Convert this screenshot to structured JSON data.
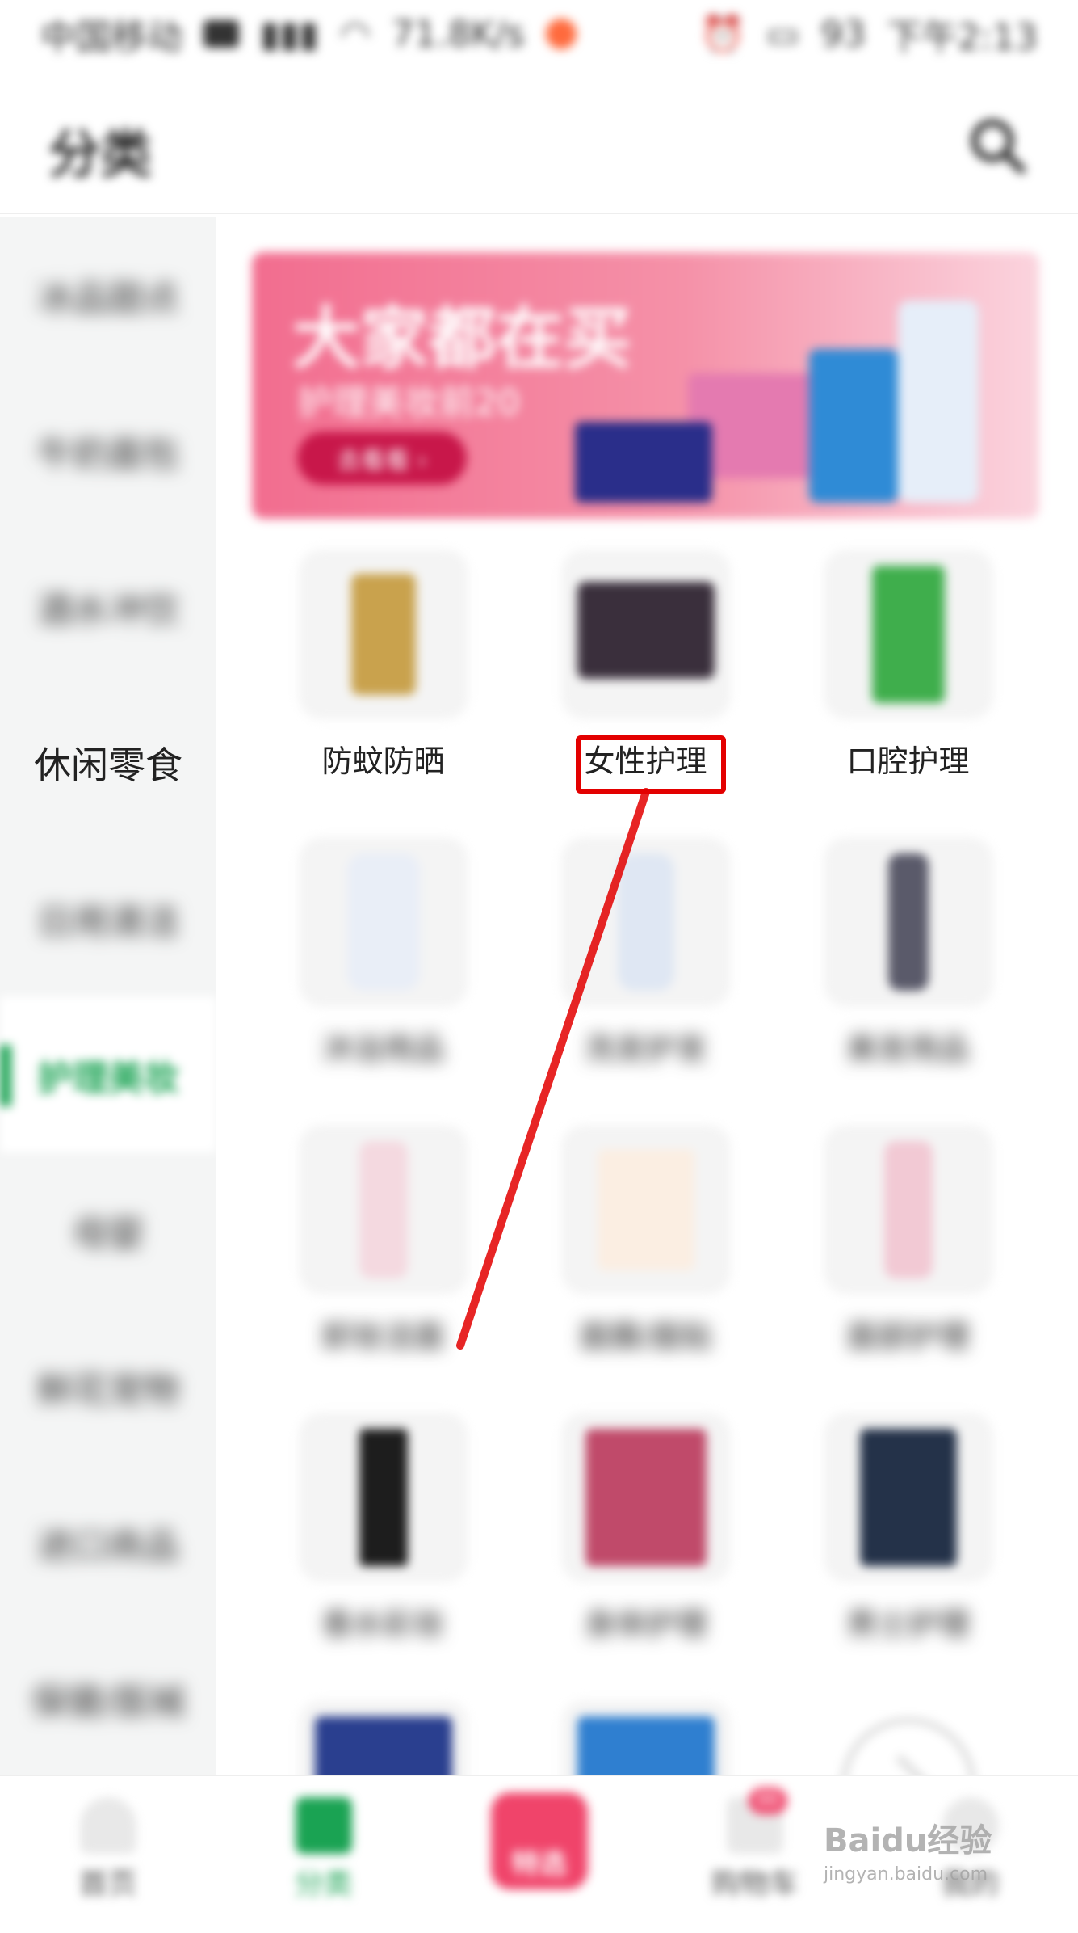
{
  "status_bar": {
    "carrier": "中国移动",
    "speed": "71.8K/s",
    "battery": "93",
    "time": "下午2:13"
  },
  "header": {
    "title": "分类"
  },
  "sidebar": {
    "items": [
      {
        "label": "冰品甜点"
      },
      {
        "label": "牛奶面包"
      },
      {
        "label": "酒水冲饮"
      },
      {
        "label": "休闲零食"
      },
      {
        "label": "日用清洁"
      },
      {
        "label": "护理美妆"
      },
      {
        "label": "母婴"
      },
      {
        "label": "鲜花宠物"
      },
      {
        "label": "进口商品"
      },
      {
        "label": "保健/医械"
      }
    ],
    "active_index": 5
  },
  "banner": {
    "title": "大家都在买",
    "subtitle": "护理美妆前20",
    "button": "去看看 ›"
  },
  "categories": [
    {
      "label": "防蚊防晒"
    },
    {
      "label": "女性护理"
    },
    {
      "label": "口腔护理"
    },
    {
      "label": "沐浴用品"
    },
    {
      "label": "洗发护发"
    },
    {
      "label": "美发用品"
    },
    {
      "label": "卸妆洁面"
    },
    {
      "label": "面膜/面贴"
    },
    {
      "label": "面部护理"
    },
    {
      "label": "香水彩妆"
    },
    {
      "label": "身体护理"
    },
    {
      "label": "男士护理"
    },
    {
      "label": ""
    },
    {
      "label": ""
    },
    {
      "label": ""
    }
  ],
  "bottom_nav": {
    "items": [
      {
        "label": "首页"
      },
      {
        "label": "分类"
      },
      {
        "label": "特选"
      },
      {
        "label": "购物车"
      },
      {
        "label": "我的"
      }
    ],
    "cart_badge": "99"
  },
  "watermark": {
    "main": "Baidu经验",
    "sub": "jingyan.baidu.com"
  },
  "colors": {
    "accent": "#1aa353",
    "highlight": "#e30000",
    "banner": "#f26d8f"
  }
}
